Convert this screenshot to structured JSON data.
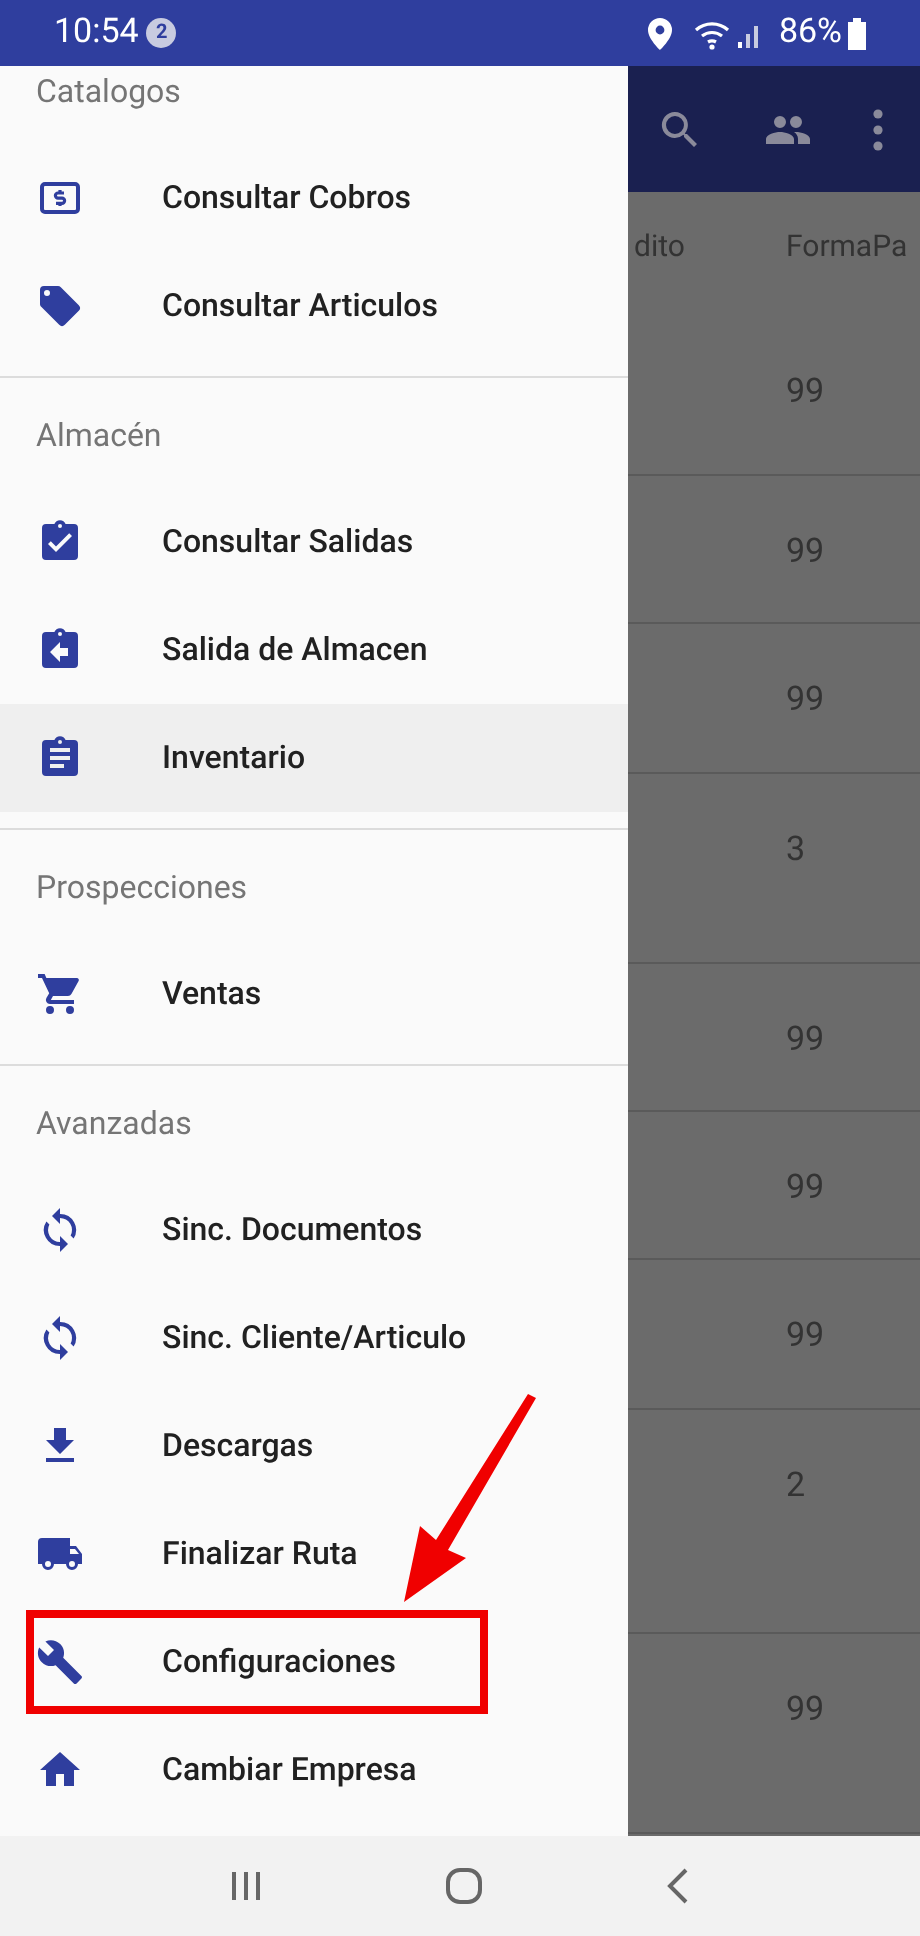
{
  "status_bar": {
    "time": "10:54",
    "notification_count": "2",
    "battery": "86%"
  },
  "table": {
    "columns": [
      "dito",
      "FormaPa"
    ],
    "rows": [
      {
        "column_2": "99"
      },
      {
        "column_2": "99"
      },
      {
        "column_2": "99"
      },
      {
        "column_2": "3"
      },
      {
        "column_2": "99"
      },
      {
        "column_2": "99"
      },
      {
        "column_2": "99"
      },
      {
        "column_2": "2"
      },
      {
        "column_2": "99"
      }
    ]
  },
  "drawer": {
    "sections": [
      {
        "title": "Catalogos",
        "items": [
          {
            "label": "Consultar Cobros",
            "selected": false,
            "highlighted": false
          },
          {
            "label": "Consultar Articulos",
            "selected": false,
            "highlighted": false
          }
        ]
      },
      {
        "title": "Almacén",
        "items": [
          {
            "label": "Consultar Salidas",
            "selected": false,
            "highlighted": false
          },
          {
            "label": "Salida de Almacen",
            "selected": false,
            "highlighted": false
          },
          {
            "label": "Inventario",
            "selected": true,
            "highlighted": false
          }
        ]
      },
      {
        "title": "Prospecciones",
        "items": [
          {
            "label": "Ventas",
            "selected": false,
            "highlighted": false
          }
        ]
      },
      {
        "title": "Avanzadas",
        "items": [
          {
            "label": "Sinc. Documentos",
            "selected": false,
            "highlighted": false
          },
          {
            "label": "Sinc. Cliente/Articulo",
            "selected": false,
            "highlighted": false
          },
          {
            "label": "Descargas",
            "selected": false,
            "highlighted": false
          },
          {
            "label": "Finalizar Ruta",
            "selected": false,
            "highlighted": false
          },
          {
            "label": "Configuraciones",
            "selected": false,
            "highlighted": true
          },
          {
            "label": "Cambiar Empresa",
            "selected": false,
            "highlighted": false
          }
        ]
      }
    ]
  }
}
